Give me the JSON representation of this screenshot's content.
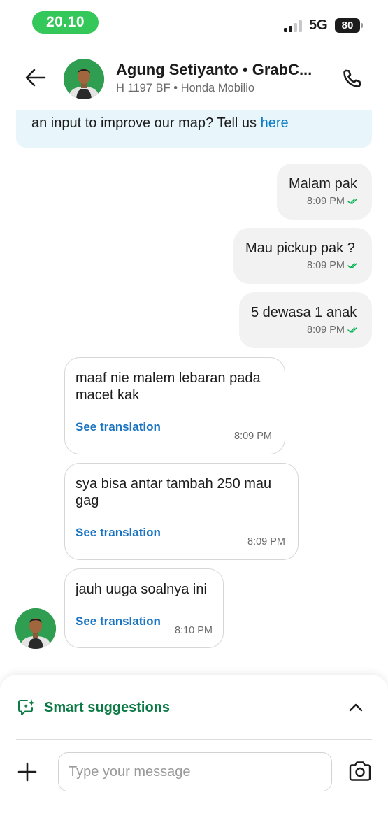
{
  "status_bar": {
    "time": "20.10",
    "network": "5G",
    "battery": "80"
  },
  "header": {
    "contact_name": "Agung Setiyanto • GrabC...",
    "vehicle_info": "H 1197 BF • Honda Mobilio"
  },
  "banner": {
    "text": "an input to improve our map? Tell us",
    "link": "here"
  },
  "messages": [
    {
      "direction": "outgoing",
      "text": "Malam pak",
      "time": "8:09 PM",
      "status": "read"
    },
    {
      "direction": "outgoing",
      "text": "Mau pickup pak ?",
      "time": "8:09 PM",
      "status": "read"
    },
    {
      "direction": "outgoing",
      "text": "5 dewasa 1 anak",
      "time": "8:09 PM",
      "status": "read"
    },
    {
      "direction": "incoming",
      "text": "maaf nie malem lebaran pada macet kak",
      "translate": "See translation",
      "time": "8:09 PM"
    },
    {
      "direction": "incoming",
      "text": "sya bisa antar tambah 250 mau gag",
      "translate": "See translation",
      "time": "8:09 PM"
    },
    {
      "direction": "incoming",
      "text": "jauh uuga soalnya ini",
      "translate": "See translation",
      "time": "8:10 PM"
    }
  ],
  "composer": {
    "suggestions_label": "Smart suggestions",
    "placeholder": "Type your message"
  },
  "colors": {
    "time_pill": "#34c759",
    "brand_green": "#0b7a44",
    "link_blue": "#1873c2",
    "banner_bg": "#e8f5fb",
    "read_check": "#00b14f"
  },
  "icons": {
    "back": "arrow-left-icon",
    "call": "phone-icon",
    "read": "double-check-icon",
    "suggestions": "sparkle-chat-icon",
    "collapse": "chevron-up-icon",
    "add": "plus-icon",
    "camera": "camera-icon"
  }
}
